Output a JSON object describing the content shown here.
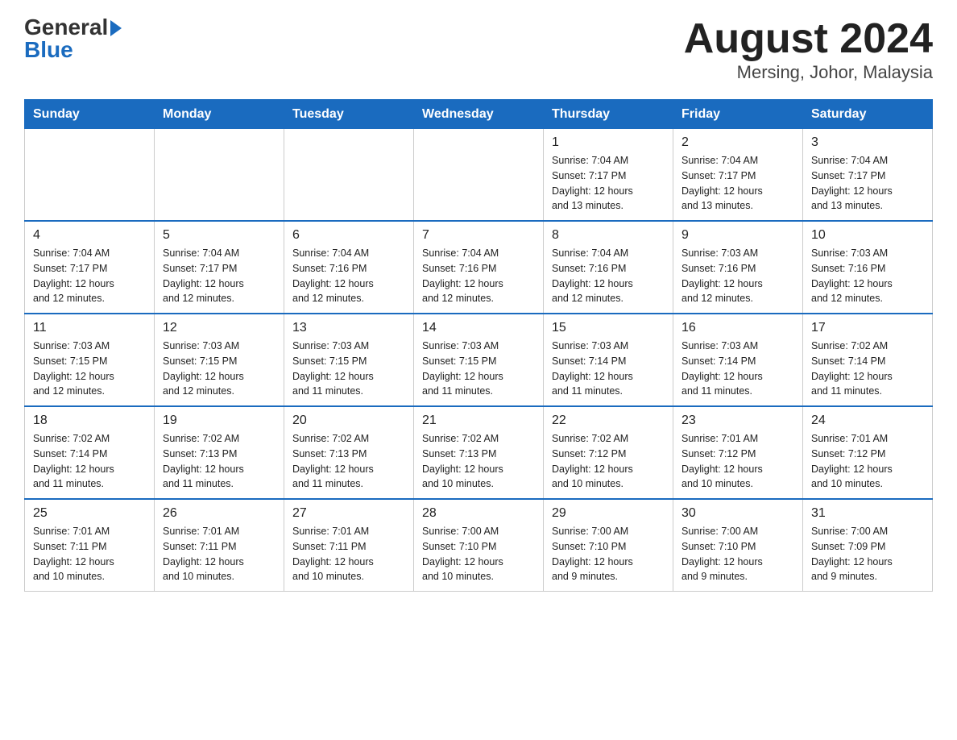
{
  "header": {
    "logo_general": "General",
    "logo_blue": "Blue",
    "title": "August 2024",
    "subtitle": "Mersing, Johor, Malaysia"
  },
  "weekdays": [
    "Sunday",
    "Monday",
    "Tuesday",
    "Wednesday",
    "Thursday",
    "Friday",
    "Saturday"
  ],
  "weeks": [
    [
      {
        "day": "",
        "info": ""
      },
      {
        "day": "",
        "info": ""
      },
      {
        "day": "",
        "info": ""
      },
      {
        "day": "",
        "info": ""
      },
      {
        "day": "1",
        "info": "Sunrise: 7:04 AM\nSunset: 7:17 PM\nDaylight: 12 hours\nand 13 minutes."
      },
      {
        "day": "2",
        "info": "Sunrise: 7:04 AM\nSunset: 7:17 PM\nDaylight: 12 hours\nand 13 minutes."
      },
      {
        "day": "3",
        "info": "Sunrise: 7:04 AM\nSunset: 7:17 PM\nDaylight: 12 hours\nand 13 minutes."
      }
    ],
    [
      {
        "day": "4",
        "info": "Sunrise: 7:04 AM\nSunset: 7:17 PM\nDaylight: 12 hours\nand 12 minutes."
      },
      {
        "day": "5",
        "info": "Sunrise: 7:04 AM\nSunset: 7:17 PM\nDaylight: 12 hours\nand 12 minutes."
      },
      {
        "day": "6",
        "info": "Sunrise: 7:04 AM\nSunset: 7:16 PM\nDaylight: 12 hours\nand 12 minutes."
      },
      {
        "day": "7",
        "info": "Sunrise: 7:04 AM\nSunset: 7:16 PM\nDaylight: 12 hours\nand 12 minutes."
      },
      {
        "day": "8",
        "info": "Sunrise: 7:04 AM\nSunset: 7:16 PM\nDaylight: 12 hours\nand 12 minutes."
      },
      {
        "day": "9",
        "info": "Sunrise: 7:03 AM\nSunset: 7:16 PM\nDaylight: 12 hours\nand 12 minutes."
      },
      {
        "day": "10",
        "info": "Sunrise: 7:03 AM\nSunset: 7:16 PM\nDaylight: 12 hours\nand 12 minutes."
      }
    ],
    [
      {
        "day": "11",
        "info": "Sunrise: 7:03 AM\nSunset: 7:15 PM\nDaylight: 12 hours\nand 12 minutes."
      },
      {
        "day": "12",
        "info": "Sunrise: 7:03 AM\nSunset: 7:15 PM\nDaylight: 12 hours\nand 12 minutes."
      },
      {
        "day": "13",
        "info": "Sunrise: 7:03 AM\nSunset: 7:15 PM\nDaylight: 12 hours\nand 11 minutes."
      },
      {
        "day": "14",
        "info": "Sunrise: 7:03 AM\nSunset: 7:15 PM\nDaylight: 12 hours\nand 11 minutes."
      },
      {
        "day": "15",
        "info": "Sunrise: 7:03 AM\nSunset: 7:14 PM\nDaylight: 12 hours\nand 11 minutes."
      },
      {
        "day": "16",
        "info": "Sunrise: 7:03 AM\nSunset: 7:14 PM\nDaylight: 12 hours\nand 11 minutes."
      },
      {
        "day": "17",
        "info": "Sunrise: 7:02 AM\nSunset: 7:14 PM\nDaylight: 12 hours\nand 11 minutes."
      }
    ],
    [
      {
        "day": "18",
        "info": "Sunrise: 7:02 AM\nSunset: 7:14 PM\nDaylight: 12 hours\nand 11 minutes."
      },
      {
        "day": "19",
        "info": "Sunrise: 7:02 AM\nSunset: 7:13 PM\nDaylight: 12 hours\nand 11 minutes."
      },
      {
        "day": "20",
        "info": "Sunrise: 7:02 AM\nSunset: 7:13 PM\nDaylight: 12 hours\nand 11 minutes."
      },
      {
        "day": "21",
        "info": "Sunrise: 7:02 AM\nSunset: 7:13 PM\nDaylight: 12 hours\nand 10 minutes."
      },
      {
        "day": "22",
        "info": "Sunrise: 7:02 AM\nSunset: 7:12 PM\nDaylight: 12 hours\nand 10 minutes."
      },
      {
        "day": "23",
        "info": "Sunrise: 7:01 AM\nSunset: 7:12 PM\nDaylight: 12 hours\nand 10 minutes."
      },
      {
        "day": "24",
        "info": "Sunrise: 7:01 AM\nSunset: 7:12 PM\nDaylight: 12 hours\nand 10 minutes."
      }
    ],
    [
      {
        "day": "25",
        "info": "Sunrise: 7:01 AM\nSunset: 7:11 PM\nDaylight: 12 hours\nand 10 minutes."
      },
      {
        "day": "26",
        "info": "Sunrise: 7:01 AM\nSunset: 7:11 PM\nDaylight: 12 hours\nand 10 minutes."
      },
      {
        "day": "27",
        "info": "Sunrise: 7:01 AM\nSunset: 7:11 PM\nDaylight: 12 hours\nand 10 minutes."
      },
      {
        "day": "28",
        "info": "Sunrise: 7:00 AM\nSunset: 7:10 PM\nDaylight: 12 hours\nand 10 minutes."
      },
      {
        "day": "29",
        "info": "Sunrise: 7:00 AM\nSunset: 7:10 PM\nDaylight: 12 hours\nand 9 minutes."
      },
      {
        "day": "30",
        "info": "Sunrise: 7:00 AM\nSunset: 7:10 PM\nDaylight: 12 hours\nand 9 minutes."
      },
      {
        "day": "31",
        "info": "Sunrise: 7:00 AM\nSunset: 7:09 PM\nDaylight: 12 hours\nand 9 minutes."
      }
    ]
  ]
}
